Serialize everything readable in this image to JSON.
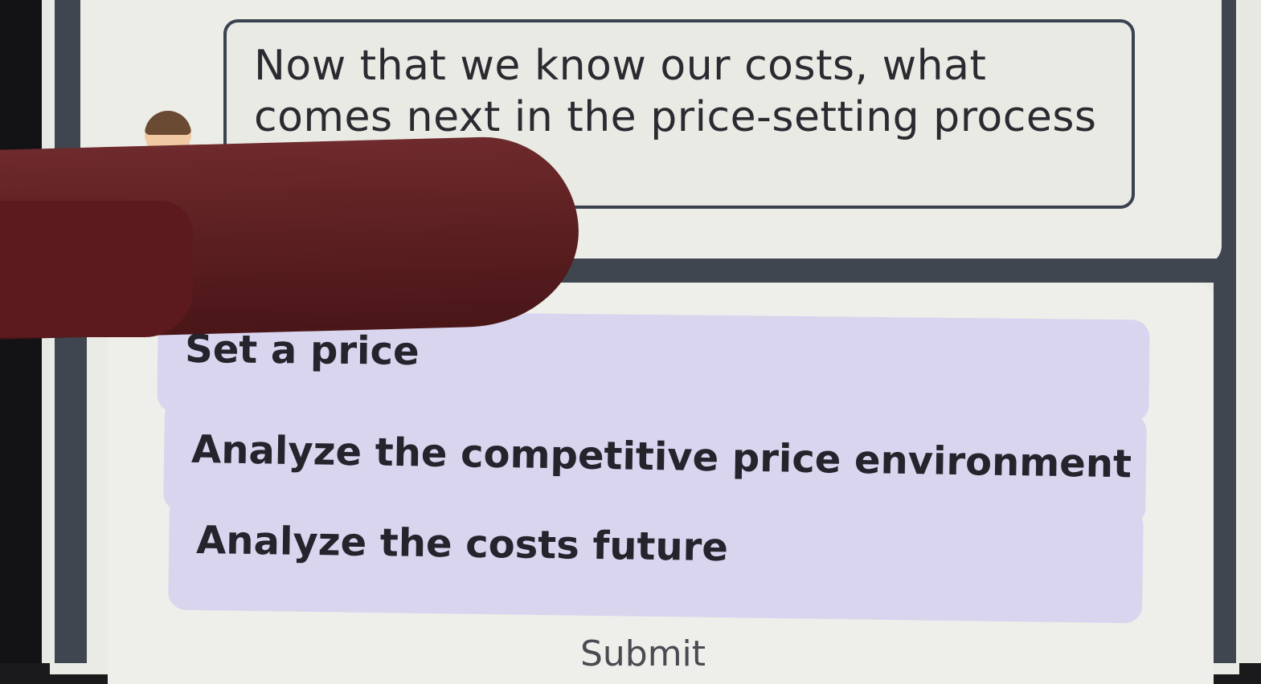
{
  "question": {
    "text": "Now that we know our costs, what comes next in the price-setting process ... ?"
  },
  "answers": {
    "options": [
      {
        "label": "Set a price"
      },
      {
        "label": "Analyze the competitive price environment"
      },
      {
        "label": "Analyze the costs future"
      }
    ]
  },
  "actions": {
    "submit_label": "Submit"
  },
  "colors": {
    "option_background": "#d9d5ef",
    "frame": "#3f4650",
    "panel_background": "#eaebe5"
  }
}
